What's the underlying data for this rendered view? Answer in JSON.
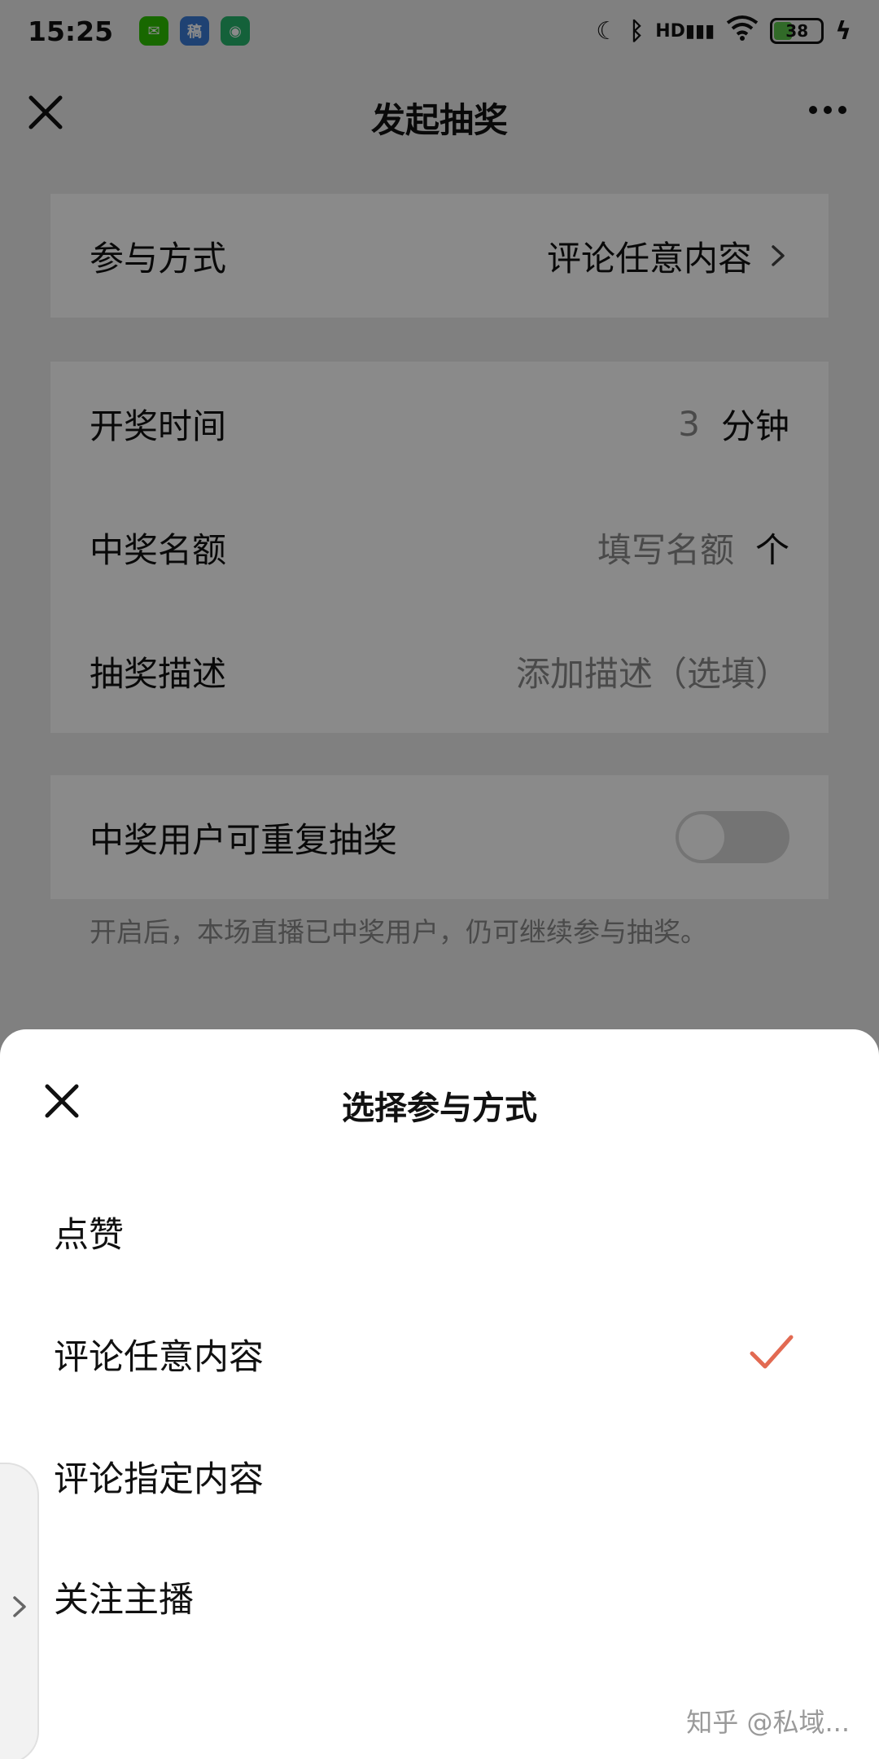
{
  "status_bar": {
    "time": "15:25",
    "apps": [
      {
        "name": "wechat-icon",
        "color": "#2dc100",
        "glyph": "✉"
      },
      {
        "name": "document-app-icon",
        "color": "#3a7bd5",
        "glyph": "稿"
      },
      {
        "name": "mi-app-icon",
        "color": "#26b36b",
        "glyph": "◉"
      }
    ],
    "network": "HD",
    "battery": "38"
  },
  "header": {
    "title": "发起抽奖"
  },
  "form": {
    "participation": {
      "label": "参与方式",
      "value": "评论任意内容"
    },
    "draw_time": {
      "label": "开奖时间",
      "number": "3",
      "unit": "分钟"
    },
    "winners": {
      "label": "中奖名额",
      "placeholder": "填写名额",
      "unit": "个"
    },
    "description": {
      "label": "抽奖描述",
      "placeholder": "添加描述（选填）"
    },
    "repeat": {
      "label": "中奖用户可重复抽奖",
      "enabled": false
    },
    "repeat_hint": "开启后，本场直播已中奖用户，仍可继续参与抽奖。"
  },
  "sheet": {
    "title": "选择参与方式",
    "options": [
      "点赞",
      "评论任意内容",
      "评论指定内容",
      "关注主播"
    ],
    "selected_index": 1,
    "check_color": "#e26a52"
  },
  "watermark": "知乎 @私域..."
}
